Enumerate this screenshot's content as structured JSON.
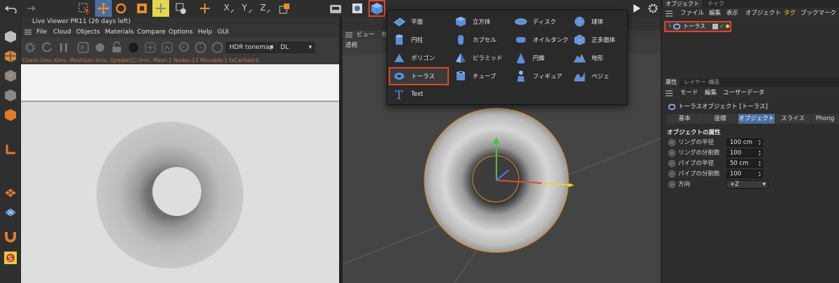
{
  "colors": {
    "highlight": "#e0452b",
    "active_tab": "#4a6fa1",
    "torus_edge": "#e08a2a",
    "status_text": "#c9733a"
  },
  "top_toolbar": {
    "icons": [
      "undo-icon",
      "redo-icon",
      "select-icon",
      "move-icon",
      "rotate-icon",
      "scale-icon",
      "live-select-icon",
      "recent-tool-icon",
      "coordinate-icon",
      "x-axis-lock-icon",
      "y-axis-lock-icon",
      "z-axis-lock-icon",
      "world-coordinate-icon",
      "render-region-icon",
      "render-view-icon",
      "cube-object-icon"
    ]
  },
  "live_viewer": {
    "title": "Live Viewer PR11 (26 days left)",
    "menu": [
      "File",
      "Cloud",
      "Objects",
      "Materials",
      "Compare",
      "Options",
      "Help",
      "GUI"
    ],
    "tonemap": "HDR tonemap",
    "mode": "DL",
    "status": "Check:0ms./0ms. MeshGen:4ms. Update(C):0ms. Mesh:1 Nodes:12 Movable:1 txCached:0"
  },
  "viewport": {
    "menu_partial": [
      "ビュー",
      "カ"
    ],
    "camera_label": "透視"
  },
  "primitive_menu": {
    "items": [
      {
        "label": "平面",
        "icon": "plane-icon"
      },
      {
        "label": "円柱",
        "icon": "cylinder-icon"
      },
      {
        "label": "ポリゴン",
        "icon": "polygon-icon"
      },
      {
        "label": "トーラス",
        "icon": "torus-icon",
        "selected": true
      },
      {
        "label": "Text",
        "icon": "text-icon"
      },
      {
        "label": "立方体",
        "icon": "cube-icon"
      },
      {
        "label": "カプセル",
        "icon": "capsule-icon"
      },
      {
        "label": "ピラミッド",
        "icon": "pyramid-icon"
      },
      {
        "label": "チューブ",
        "icon": "tube-icon"
      },
      {
        "label": "ディスク",
        "icon": "disc-icon"
      },
      {
        "label": "オイルタンク",
        "icon": "oil-tank-icon"
      },
      {
        "label": "円錐",
        "icon": "cone-icon"
      },
      {
        "label": "フィギュア",
        "icon": "figure-icon"
      },
      {
        "label": "球体",
        "icon": "sphere-icon"
      },
      {
        "label": "正多面体",
        "icon": "platonic-icon"
      },
      {
        "label": "地形",
        "icon": "landscape-icon"
      },
      {
        "label": "ベジェ",
        "icon": "bezier-icon"
      }
    ]
  },
  "object_manager": {
    "tabs": [
      "オブジェクト",
      "テイク"
    ],
    "menu": [
      "ファイル",
      "編集",
      "表示",
      "オブジェクト",
      "タグ",
      "ブックマーク"
    ],
    "object_name": "トーラス"
  },
  "attribute_manager": {
    "tabs": [
      "属性",
      "レイヤー",
      "構造"
    ],
    "menu": [
      "モード",
      "編集",
      "ユーザーデータ"
    ],
    "object_title": "トーラスオブジェクト [トーラス]",
    "sub_tabs": [
      "基本",
      "座標",
      "オブジェクト",
      "スライス",
      "Phong"
    ],
    "active_sub_tab": "オブジェクト",
    "section_title": "オブジェクトの属性",
    "params": [
      {
        "label": "リングの半径",
        "value": "100 cm"
      },
      {
        "label": "リングの分割数",
        "value": "100"
      },
      {
        "label": "パイプの半径",
        "value": "50 cm"
      },
      {
        "label": "パイプの分割数",
        "value": "100"
      },
      {
        "label": "方向",
        "value": "+Z"
      }
    ]
  }
}
